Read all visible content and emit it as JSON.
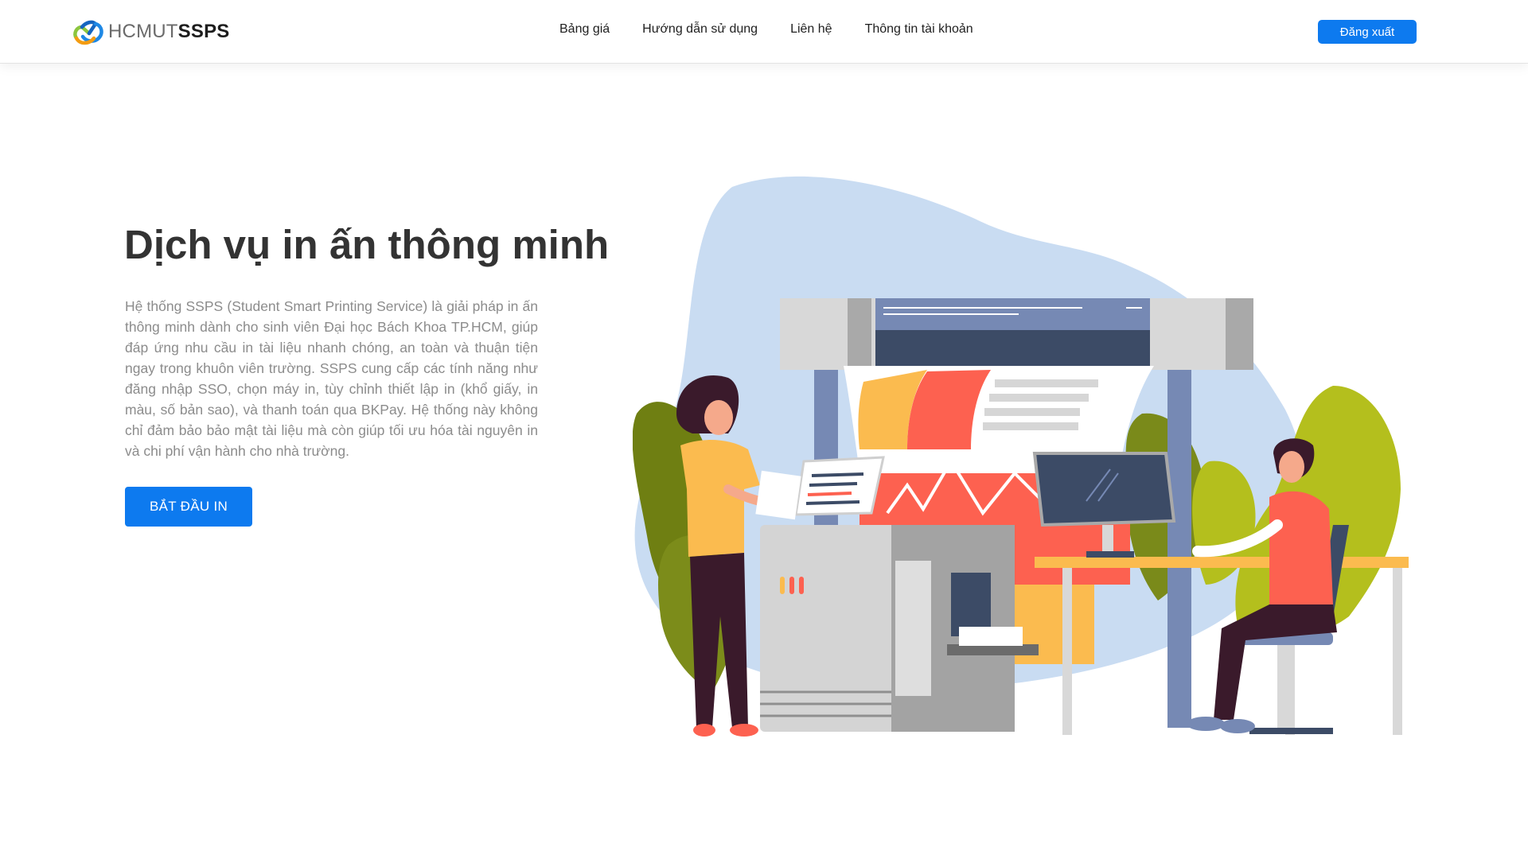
{
  "header": {
    "logo": {
      "light": "HCMUT",
      "bold": "SSPS"
    },
    "nav": [
      {
        "label": "Bảng giá"
      },
      {
        "label": "Hướng dẫn sử dụng"
      },
      {
        "label": "Liên hệ"
      },
      {
        "label": "Thông tin tài khoản"
      }
    ],
    "logout_label": "Đăng xuất"
  },
  "hero": {
    "title": "Dịch vụ in ấn thông minh",
    "description": "Hệ thống SSPS (Student Smart Printing Service) là giải pháp in ấn thông minh dành cho sinh viên Đại học Bách Khoa TP.HCM, giúp đáp ứng nhu cầu in tài liệu nhanh chóng, an toàn và thuận tiện ngay trong khuôn viên trường. SSPS cung cấp các tính năng như đăng nhập SSO, chọn máy in, tùy chỉnh thiết lập in (khổ giấy, in màu, số bản sao), và thanh toán qua BKPay. Hệ thống này không chỉ đảm bảo bảo mật tài liệu mà còn giúp tối ưu hóa tài nguyên in và chi phí vận hành cho nhà trường.",
    "cta_label": "BẮT ĐẦU IN"
  },
  "colors": {
    "primary": "#0d7aef",
    "blob": "#c9dcf2",
    "leaf_olive": "#7a8a1a",
    "leaf_lime": "#b5bf1e",
    "orange": "#fbbb4f",
    "coral": "#fd6150",
    "printer_blue": "#7689b4"
  },
  "icons": {
    "logo": "hcmut-logo-icon",
    "illustration": "printing-service-illustration"
  }
}
